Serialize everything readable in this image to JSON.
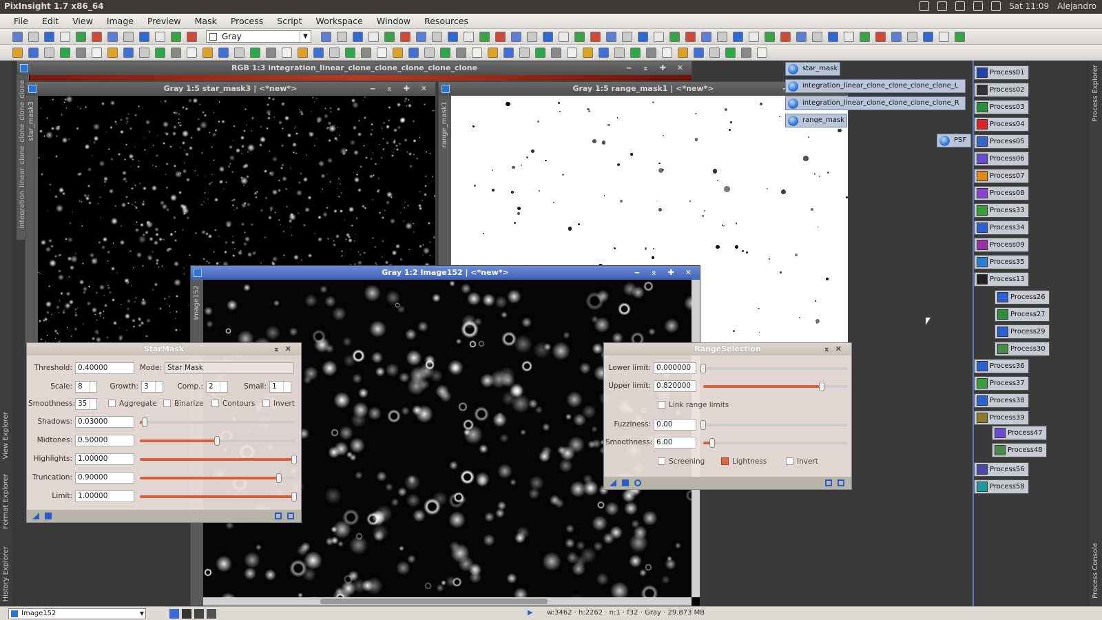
{
  "os_bar": {
    "app_title": "PixInsight 1.7 x86_64",
    "clock": "Sat 11:09",
    "user": "Alejandro"
  },
  "menu": [
    "File",
    "Edit",
    "View",
    "Image",
    "Preview",
    "Mask",
    "Process",
    "Script",
    "Workspace",
    "Window",
    "Resources"
  ],
  "toolbar": {
    "colorspace_combo": "Gray"
  },
  "windows": {
    "rgb": {
      "title": "RGB 1:3 integration_linear_clone_clone_clone_clone_clone",
      "side": "integration_linear_clone_clone_clone_clone"
    },
    "starmask3": {
      "title": "Gray 1:5 star_mask3 | <*new*>",
      "side": "star_mask3"
    },
    "rangemask1": {
      "title": "Gray 1:5 range_mask1 | <*new*>",
      "side": "range_mask1"
    },
    "image152": {
      "title": "Gray 1:2 Image152 | <*new*>",
      "side": "Image152"
    }
  },
  "starmask_dialog": {
    "title": "StarMask",
    "threshold_label": "Threshold:",
    "threshold": "0.40000",
    "mode_label": "Mode:",
    "mode": "Star Mask",
    "scale_label": "Scale:",
    "scale": "8",
    "growth_label": "Growth:",
    "growth": "3",
    "comp_label": "Comp.:",
    "comp": "2",
    "small_label": "Small:",
    "small": "1",
    "smoothness_label": "Smoothness:",
    "smoothness": "35",
    "aggregate": "Aggregate",
    "binarize": "Binarize",
    "contours": "Contours",
    "invert": "Invert",
    "shadows_label": "Shadows:",
    "shadows": "0.03000",
    "midtones_label": "Midtones:",
    "midtones": "0.50000",
    "highlights_label": "Highlights:",
    "highlights": "1.00000",
    "truncation_label": "Truncation:",
    "truncation": "0.90000",
    "limit_label": "Limit:",
    "limit": "1.00000",
    "slider_levels": {
      "shadows": 0.03,
      "midtones": 0.5,
      "highlights": 1.0,
      "truncation": 0.9,
      "limit": 1.0
    }
  },
  "range_dialog": {
    "title": "RangeSelection",
    "lower_label": "Lower limit:",
    "lower": "0.000000",
    "upper_label": "Upper limit:",
    "upper": "0.820000",
    "link": "Link range limits",
    "fuzziness_label": "Fuzziness:",
    "fuzziness": "0.00",
    "smoothness_label": "Smoothness:",
    "smoothness": "6.00",
    "screening": "Screening",
    "lightness": "Lightness",
    "invert": "Invert",
    "slider_levels": {
      "lower": 0.0,
      "upper": 0.82,
      "fuzziness": 0.0,
      "smoothness": 0.06
    }
  },
  "image_icons": [
    "star_mask",
    "integration_linear_clone_clone_clone_clone_L",
    "integration_linear_clone_clone_clone_clone_R",
    "range_mask",
    "PSF"
  ],
  "process_icons": [
    "Process01",
    "Process02",
    "Process03",
    "Process04",
    "Process05",
    "Process06",
    "Process07",
    "Process08",
    "Process33",
    "Process34",
    "Process09",
    "Process35",
    "Process13",
    "Process26",
    "Process27",
    "Process29",
    "Process30",
    "Process36",
    "Process37",
    "Process38",
    "Process39",
    "Process47",
    "Process48",
    "Process56",
    "Process58"
  ],
  "side_panels": {
    "left": [
      "View Explorer",
      "Format Explorer",
      "History Explorer"
    ],
    "right": [
      "Process Explorer",
      "Process Console"
    ]
  },
  "statusbar": {
    "view_combo": "Image152",
    "info": "w:3462  · h:2262  · n:1  · f32  · Gray  · 29.873 MB"
  },
  "colors": {
    "slider_fill": "#d4603c",
    "active_title": "#3f62b8"
  }
}
